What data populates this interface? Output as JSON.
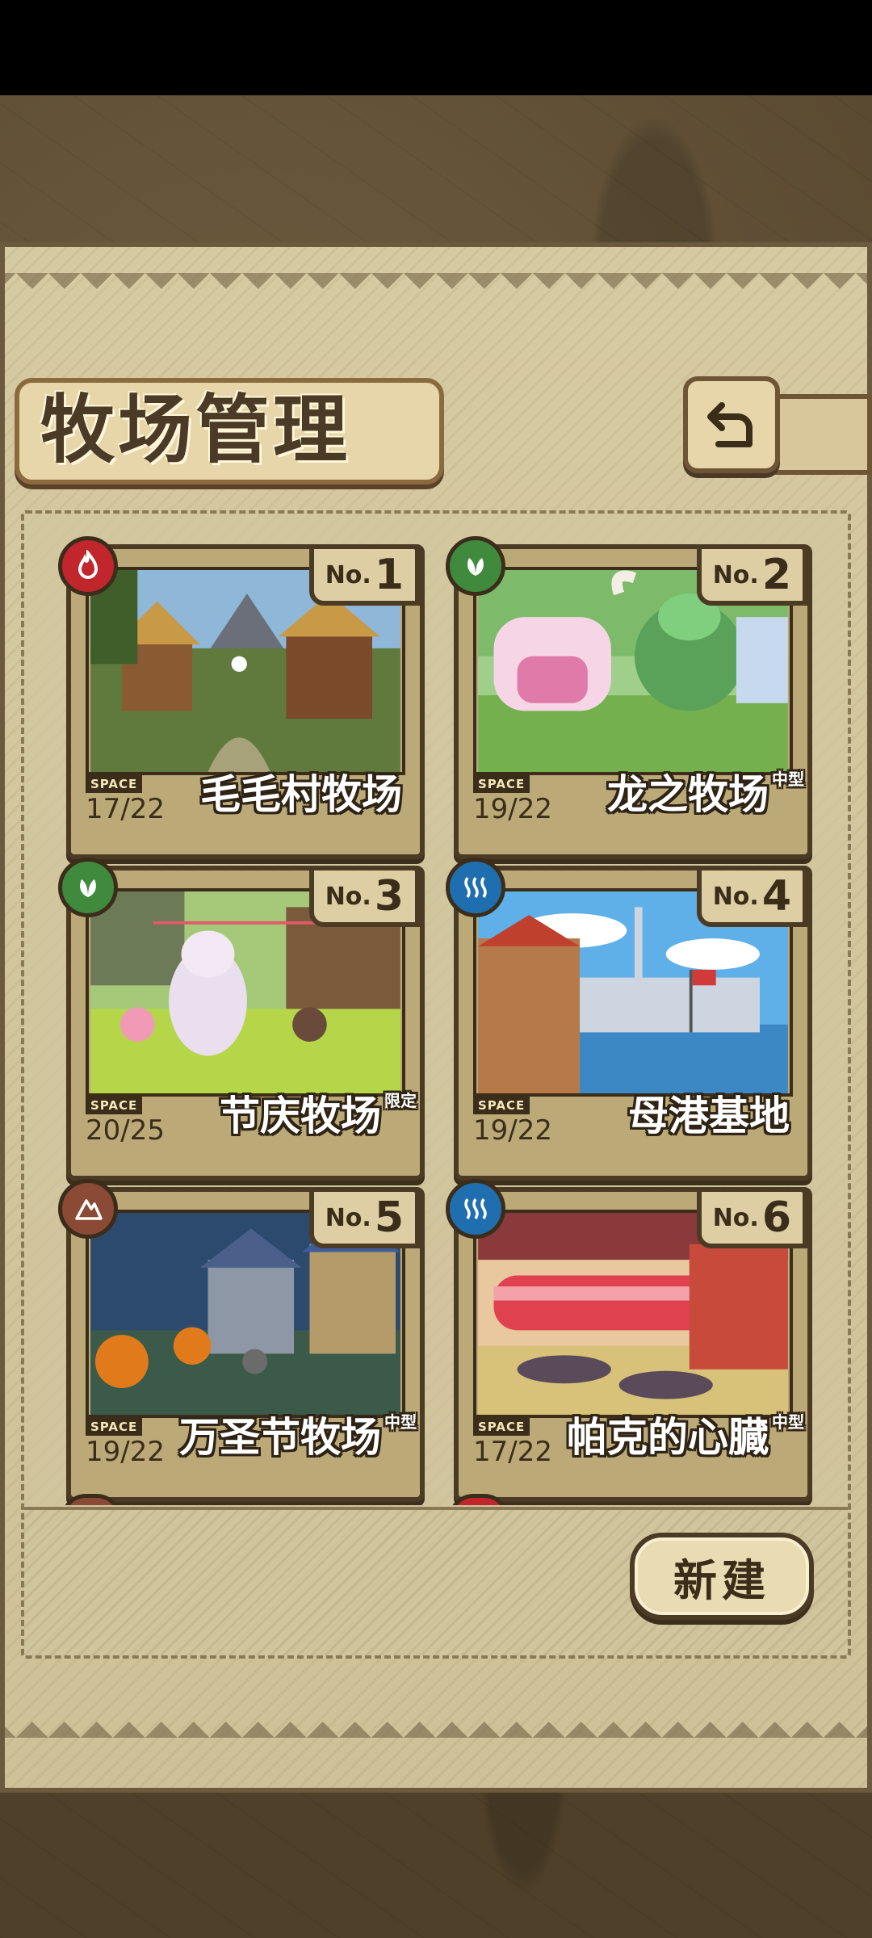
{
  "title": "牧场管理",
  "new_button": "新建",
  "space_label": "SPACE",
  "no_prefix": "No.",
  "ranches": [
    {
      "no": "1",
      "name": "毛毛村牧场",
      "size_tag": "",
      "space": "17/22",
      "type_icon": "fire-icon",
      "type_color": "#c0262b"
    },
    {
      "no": "2",
      "name": "龙之牧场",
      "size_tag": "中型",
      "space": "19/22",
      "type_icon": "leaf-icon",
      "type_color": "#3f8a3c"
    },
    {
      "no": "3",
      "name": "节庆牧场",
      "size_tag": "限定",
      "space": "20/25",
      "type_icon": "leaf-icon",
      "type_color": "#3f8a3c"
    },
    {
      "no": "4",
      "name": "母港基地",
      "size_tag": "",
      "space": "19/22",
      "type_icon": "water-icon",
      "type_color": "#1f6fb0"
    },
    {
      "no": "5",
      "name": "万圣节牧场",
      "size_tag": "中型",
      "space": "19/22",
      "type_icon": "earth-icon",
      "type_color": "#8a4a35"
    },
    {
      "no": "6",
      "name": "帕克的心臓",
      "size_tag": "中型",
      "space": "17/22",
      "type_icon": "water-icon",
      "type_color": "#1f6fb0"
    }
  ]
}
